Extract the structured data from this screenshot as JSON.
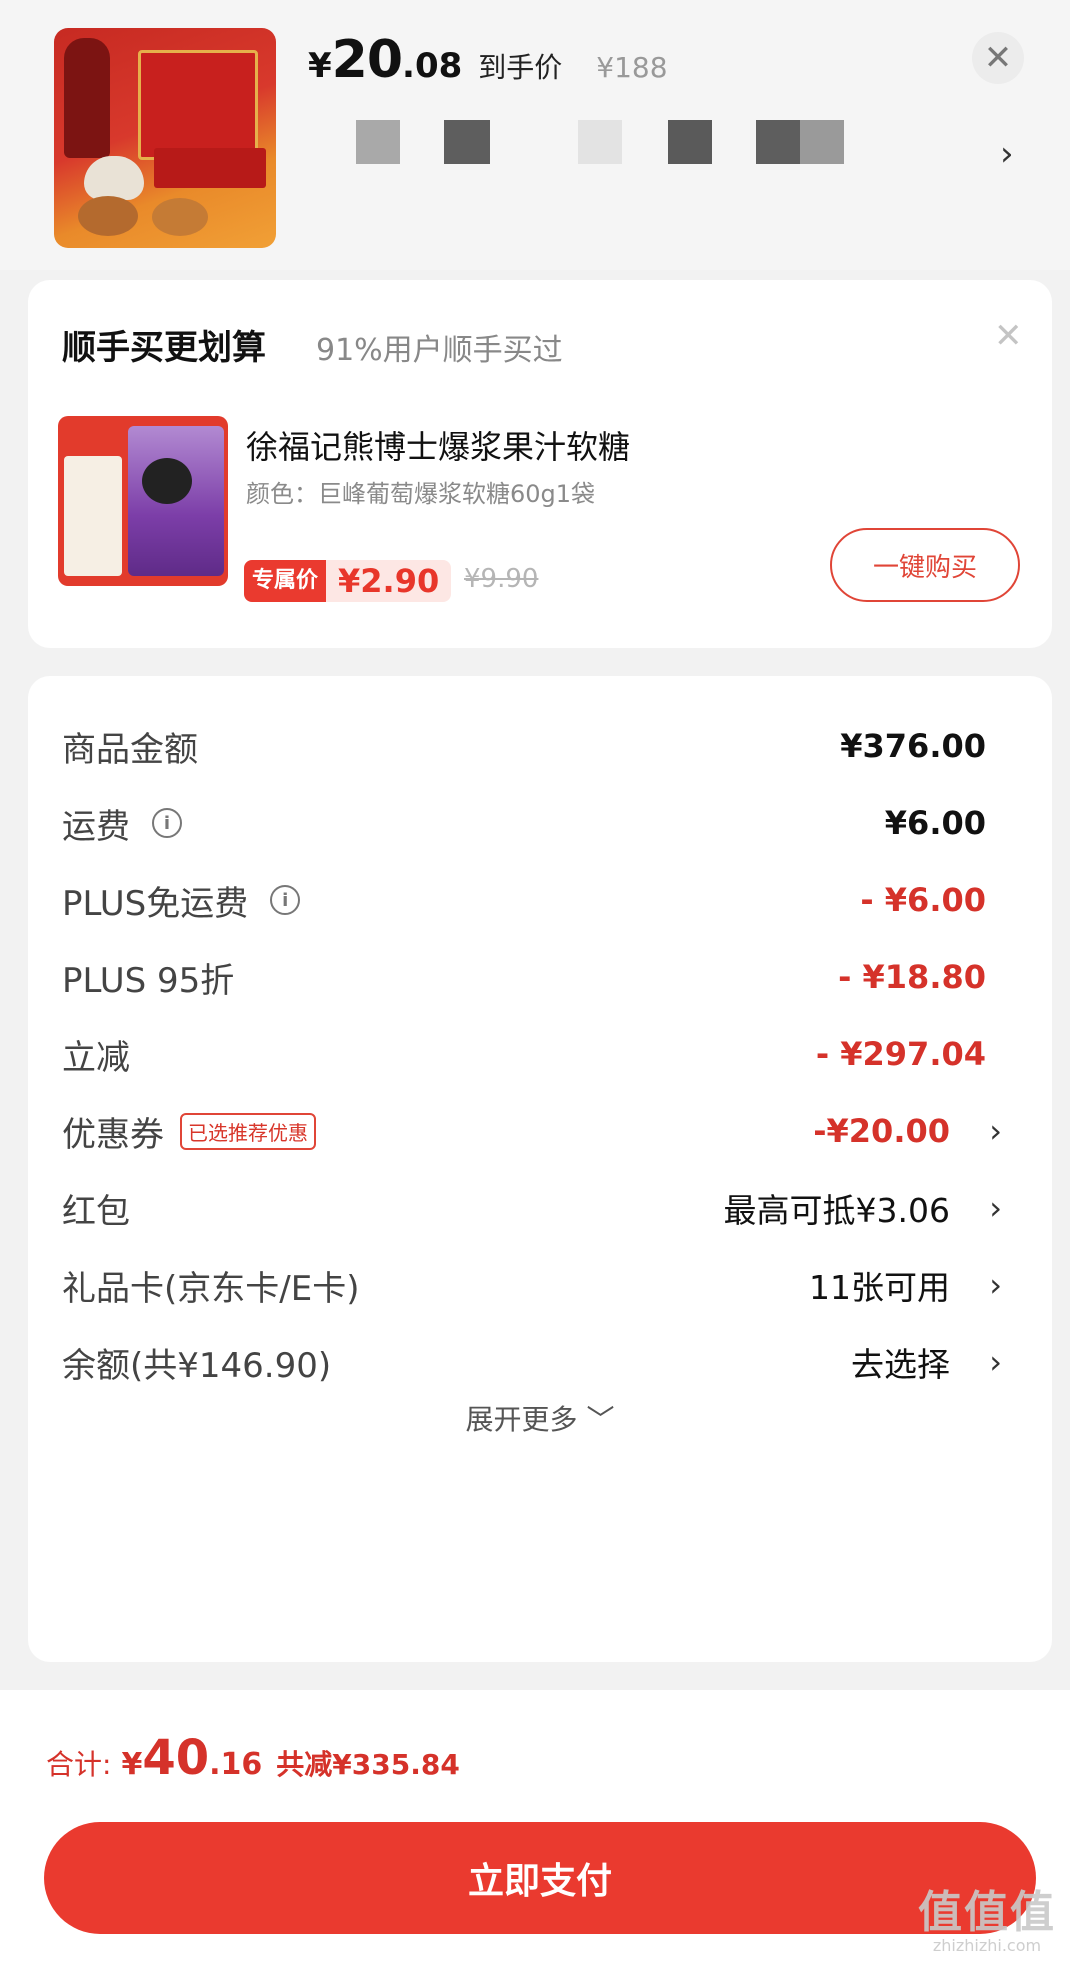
{
  "header": {
    "price_currency": "¥",
    "price_int": "20",
    "price_dec": ".08",
    "price_label": "到手价",
    "original_price": "¥188",
    "close_icon": "close-icon",
    "chevron_icon": "chevron-right-icon"
  },
  "addon": {
    "title": "顺手买更划算",
    "subtitle": "91%用户顺手买过",
    "product_name": "徐福记熊博士爆浆果汁软糖",
    "spec": "颜色：巨峰葡萄爆浆软糖60g1袋",
    "exclusive_label": "专属价",
    "exclusive_price": "¥2.90",
    "original_price": "¥9.90",
    "buy_button": "一键购买"
  },
  "summary": {
    "rows": [
      {
        "label": "商品金额",
        "value": "¥376.00"
      },
      {
        "label": "运费",
        "value": "¥6.00"
      },
      {
        "label": "PLUS免运费",
        "value": "- ¥6.00"
      },
      {
        "label": "PLUS 95折",
        "value": "- ¥18.80"
      },
      {
        "label": "立减",
        "value": "- ¥297.04"
      },
      {
        "label": "优惠券",
        "tag": "已选推荐优惠",
        "value": "-¥20.00"
      },
      {
        "label": "红包",
        "value": "最高可抵¥3.06"
      },
      {
        "label": "礼品卡(京东卡/E卡)",
        "value": "11张可用"
      },
      {
        "label": "余额(共¥146.90)",
        "value": "去选择"
      }
    ],
    "expand_label": "展开更多 ﹀"
  },
  "footer": {
    "total_label": "合计:",
    "total_currency": "¥",
    "total_int": "40",
    "total_dec": ".16",
    "saved": "共减¥335.84",
    "pay_button": "立即支付"
  },
  "watermark": {
    "main": "值值值",
    "sub": "zhizhizhi.com"
  },
  "colors": {
    "accent": "#ea3a2f",
    "discount_red": "#d5322a",
    "background": "#f2f2f2"
  }
}
